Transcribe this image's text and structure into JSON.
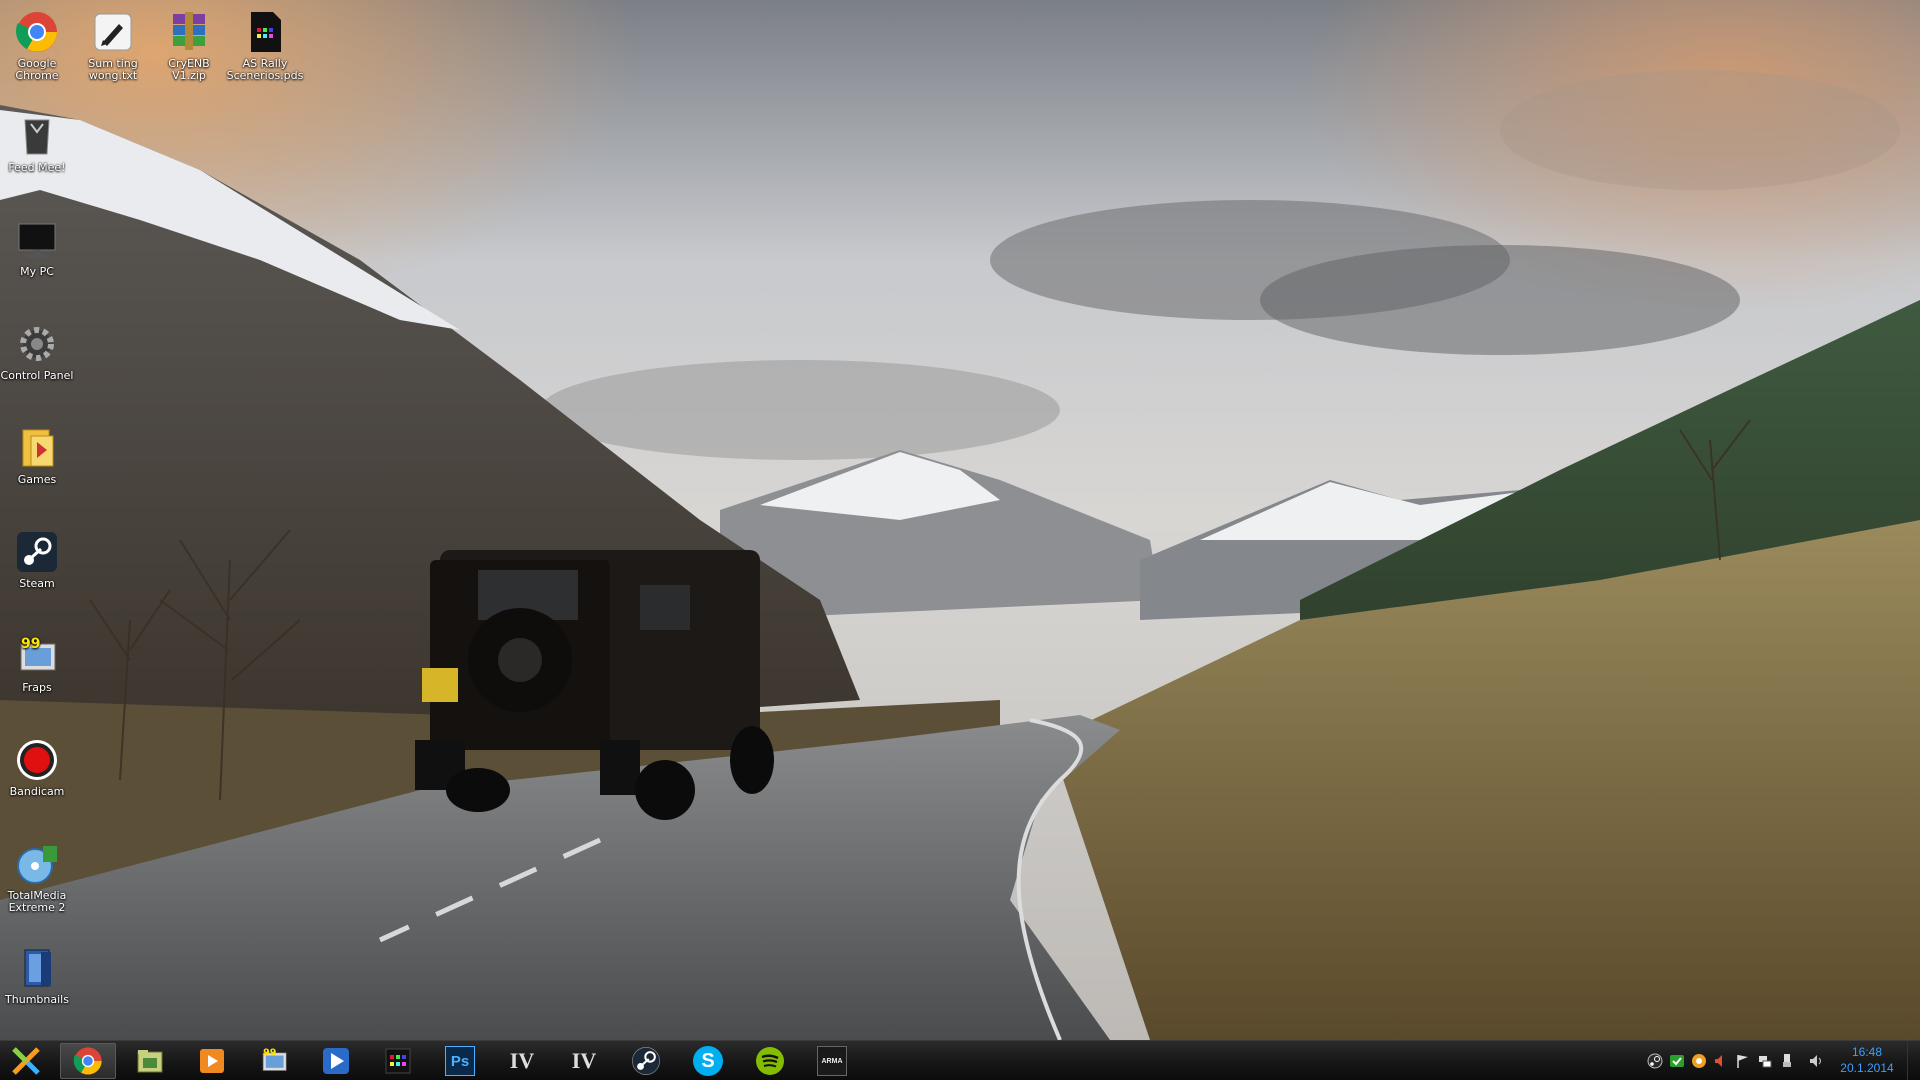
{
  "desktop": {
    "top_icons": [
      {
        "name": "google-chrome-shortcut",
        "label": "Google Chrome",
        "icon": "chrome-icon"
      },
      {
        "name": "text-file-shortcut",
        "label": "Sum ting wong.txt",
        "icon": "notepad-icon"
      },
      {
        "name": "zip-archive-shortcut",
        "label": "CryENB V1.zip",
        "icon": "winrar-icon"
      },
      {
        "name": "pds-file-shortcut",
        "label": "AS Rally Scenerios.pds",
        "icon": "pds-file-icon"
      }
    ],
    "left_icons": [
      {
        "name": "feed-mee-shortcut",
        "label": "Feed Mee!",
        "icon": "feed-icon"
      },
      {
        "name": "my-pc-shortcut",
        "label": "My PC",
        "icon": "monitor-icon"
      },
      {
        "name": "control-panel-shortcut",
        "label": "Control Panel",
        "icon": "gear-icon"
      },
      {
        "name": "games-shortcut",
        "label": "Games",
        "icon": "games-folder-icon"
      },
      {
        "name": "steam-shortcut",
        "label": "Steam",
        "icon": "steam-icon"
      },
      {
        "name": "fraps-shortcut",
        "label": "Fraps",
        "icon": "fraps-icon"
      },
      {
        "name": "bandicam-shortcut",
        "label": "Bandicam",
        "icon": "record-icon"
      },
      {
        "name": "totalmedia-shortcut",
        "label": "TotalMedia Extreme 2",
        "icon": "totalmedia-icon"
      },
      {
        "name": "thumbnails-shortcut",
        "label": "Thumbnails",
        "icon": "thumbnails-folder-icon"
      }
    ]
  },
  "taskbar": {
    "start_icon": "start-x-icon",
    "pinned": [
      {
        "name": "taskbar-chrome",
        "icon": "chrome-icon",
        "active": true
      },
      {
        "name": "taskbar-explorer",
        "icon": "folder-icon",
        "active": false
      },
      {
        "name": "taskbar-media-player",
        "icon": "media-player-icon",
        "active": false
      },
      {
        "name": "taskbar-fraps",
        "icon": "fraps-icon",
        "active": false
      },
      {
        "name": "taskbar-totalmedia",
        "icon": "play-icon",
        "active": false
      },
      {
        "name": "taskbar-pds",
        "icon": "pds-file-icon",
        "active": false
      },
      {
        "name": "taskbar-photoshop",
        "icon": "photoshop-icon",
        "label": "Ps",
        "active": false
      },
      {
        "name": "taskbar-gta-iv-a",
        "icon": "gta-iv-icon",
        "label": "IV",
        "active": false
      },
      {
        "name": "taskbar-gta-iv-b",
        "icon": "gta-iv-icon",
        "label": "IV",
        "active": false
      },
      {
        "name": "taskbar-steam",
        "icon": "steam-icon",
        "active": false
      },
      {
        "name": "taskbar-skype",
        "icon": "skype-icon",
        "label": "S",
        "active": false
      },
      {
        "name": "taskbar-spotify",
        "icon": "spotify-icon",
        "active": false
      },
      {
        "name": "taskbar-arma",
        "icon": "arma-icon",
        "label": "ARMA",
        "active": false
      }
    ],
    "tray_icons": [
      "steam-tray-icon",
      "security-tray-icon",
      "update-tray-icon",
      "volume-mute-icon",
      "flag-icon",
      "network-icon",
      "usb-icon",
      "speaker-icon"
    ],
    "clock_time": "16:48",
    "clock_date": "20.1.2014",
    "clock_color": "#3aa0ff"
  }
}
